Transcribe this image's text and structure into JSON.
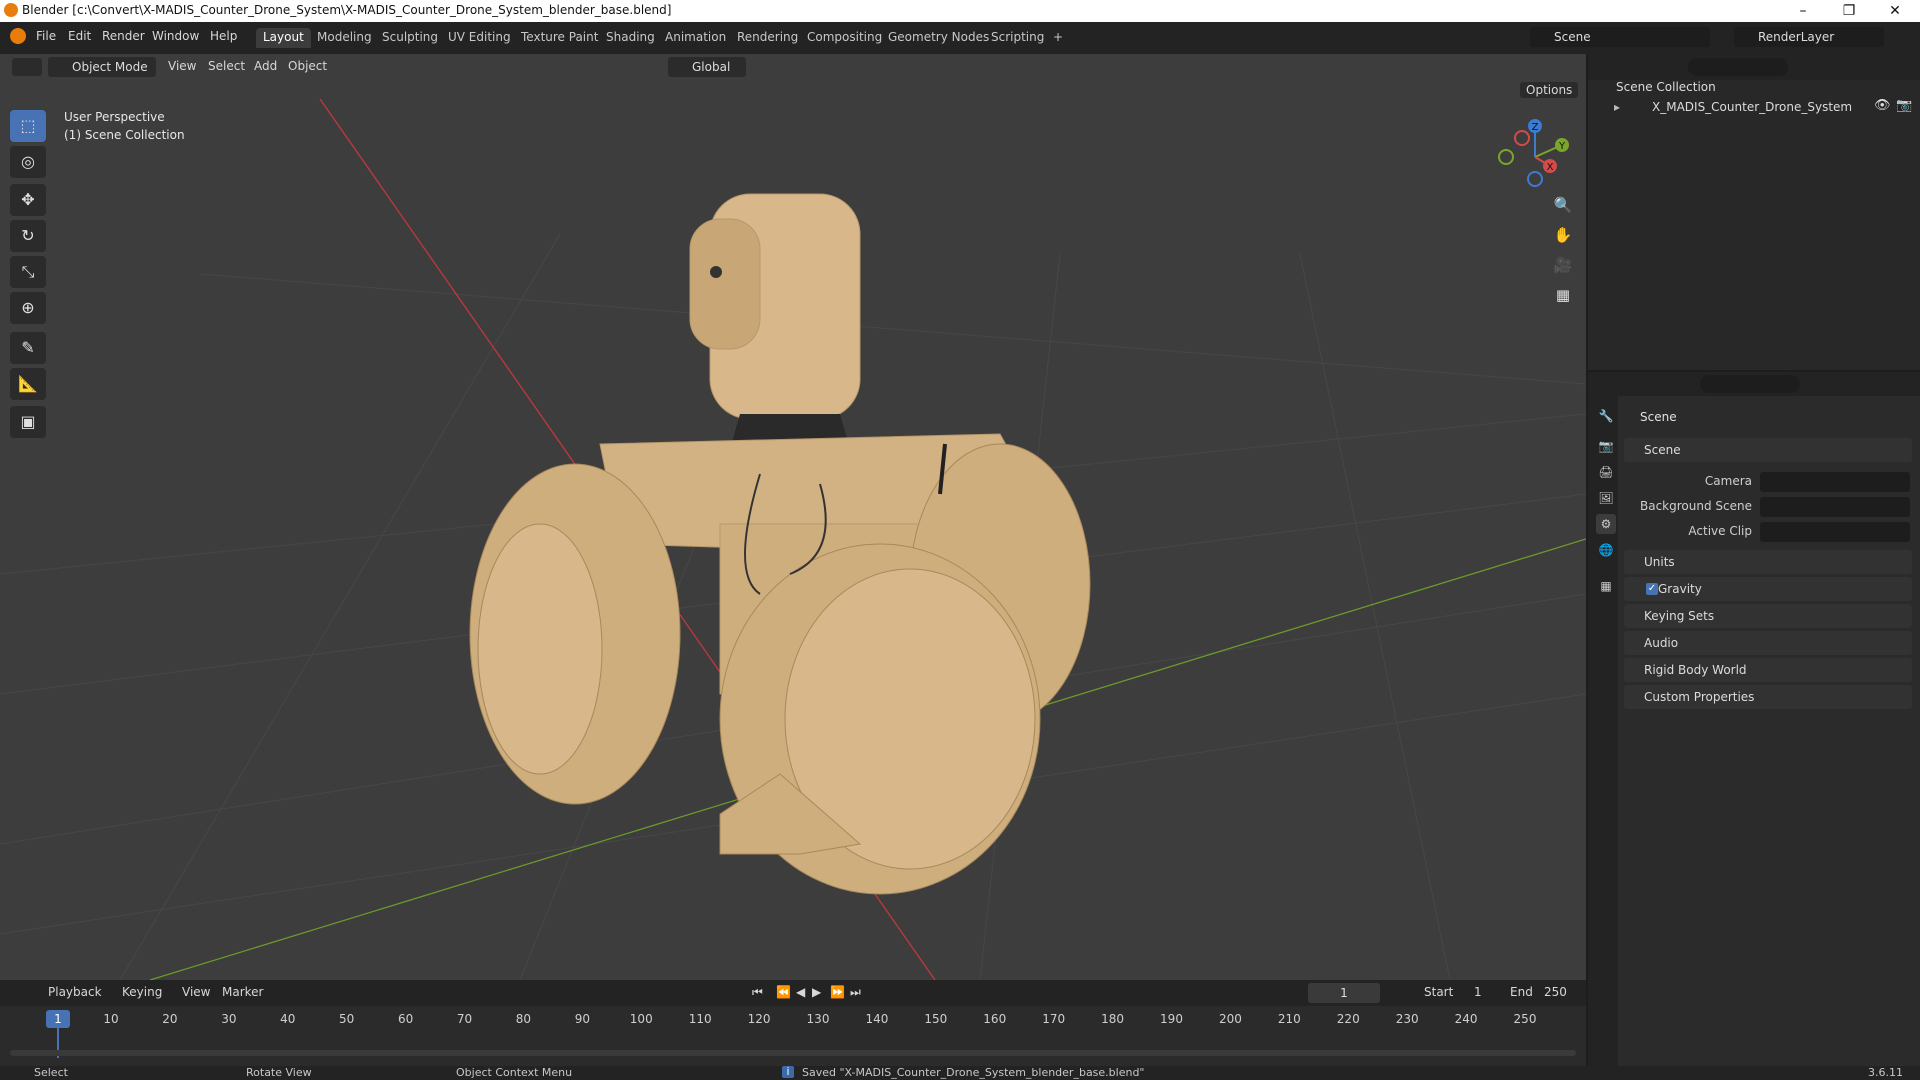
{
  "window": {
    "title": "Blender [c:\\Convert\\X-MADIS_Counter_Drone_System\\X-MADIS_Counter_Drone_System_blender_base.blend]",
    "minimize": "–",
    "maximize": "❐",
    "close": "✕"
  },
  "menubar": {
    "items": [
      "File",
      "Edit",
      "Render",
      "Window",
      "Help"
    ],
    "workspaces": [
      "Layout",
      "Modeling",
      "Sculpting",
      "UV Editing",
      "Texture Paint",
      "Shading",
      "Animation",
      "Rendering",
      "Compositing",
      "Geometry Nodes",
      "Scripting"
    ],
    "active_workspace": "Layout",
    "add_tab": "+",
    "scene": "Scene",
    "view_layer": "RenderLayer"
  },
  "viewport": {
    "mode": "Object Mode",
    "menus": [
      "View",
      "Select",
      "Add",
      "Object"
    ],
    "transform_orientation": "Global",
    "options_label": "Options",
    "info_line1": "User Perspective",
    "info_line2": "(1) Scene Collection",
    "gizmo": {
      "x": "X",
      "y": "Y",
      "z": "Z"
    }
  },
  "outliner": {
    "root": "Scene Collection",
    "items": [
      {
        "label": "X_MADIS_Counter_Drone_System"
      }
    ]
  },
  "properties": {
    "header": "Scene",
    "section": "Scene",
    "fields": [
      {
        "label": "Camera"
      },
      {
        "label": "Background Scene"
      },
      {
        "label": "Active Clip"
      }
    ],
    "panels": [
      "Units",
      "Gravity",
      "Keying Sets",
      "Audio",
      "Rigid Body World",
      "Custom Properties"
    ],
    "gravity_checked": true
  },
  "timeline": {
    "menus": [
      "Playback",
      "Keying",
      "View",
      "Marker"
    ],
    "current_frame": "1",
    "start_label": "Start",
    "start": "1",
    "end_label": "End",
    "end": "250",
    "ticks": [
      "1",
      "10",
      "20",
      "30",
      "40",
      "50",
      "60",
      "70",
      "80",
      "90",
      "100",
      "110",
      "120",
      "130",
      "140",
      "150",
      "160",
      "170",
      "180",
      "190",
      "200",
      "210",
      "220",
      "230",
      "240",
      "250"
    ]
  },
  "statusbar": {
    "select": "Select",
    "rotate": "Rotate View",
    "context": "Object Context Menu",
    "message": "Saved \"X-MADIS_Counter_Drone_System_blender_base.blend\"",
    "version": "3.6.11"
  },
  "colors": {
    "accent": "#4772b3",
    "model": "#d8b88a",
    "x_axis": "#c0393b",
    "y_axis": "#6b9a2b"
  }
}
